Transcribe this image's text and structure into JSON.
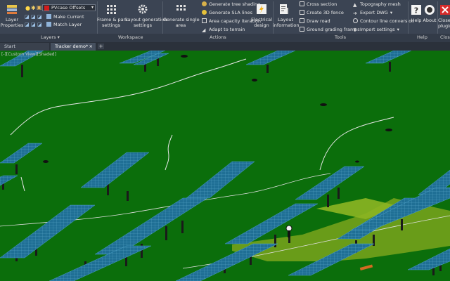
{
  "ribbon": {
    "layers": {
      "layer_properties": "Layer\nProperties",
      "current_layer": "PVcase Offsets",
      "make_current": "Make Current",
      "match_layer": "Match Layer",
      "group_title": "Layers"
    },
    "workspace": {
      "frame_park": "Frame & park\nsettings",
      "layout_gen": "Layout generation\nsettings",
      "group_title": "Workspace"
    },
    "actions": {
      "generate_single_area": "Generate single\narea",
      "generate_tree_shading": "Generate tree shading",
      "generate_sla_lines": "Generate SLA lines",
      "area_capacity": "Area capacity iteration",
      "adapt_terrain": "Adapt to terrain",
      "electrical_design": "Electrical\ndesign",
      "group_title": "Actions"
    },
    "tools": {
      "layout_information": "Layout\ninformation",
      "cross_section": "Cross section",
      "create_3d_fence": "Create 3D fence",
      "draw_road": "Draw road",
      "ground_grading": "Ground grading frames",
      "topography_mesh": "Topography mesh",
      "export_dwg": "Export DWG",
      "contour_conversion": "Contour line conversion",
      "import_settings": "Import settings",
      "group_title": "Tools"
    },
    "help": {
      "help_label": "Help",
      "about_label": "About",
      "group_title": "Help"
    },
    "close": {
      "close_label": "Close\nplugin",
      "group_title": "Close"
    }
  },
  "tabs": {
    "start": "Start",
    "active": "Tracker demo*"
  },
  "viewport": {
    "label": "[-][Custom View][Shaded]"
  },
  "colors": {
    "ground": "#0b6e0b",
    "panel": "#1f6f95",
    "grading": "#7aa51c",
    "ribbon": "#3b4453"
  }
}
